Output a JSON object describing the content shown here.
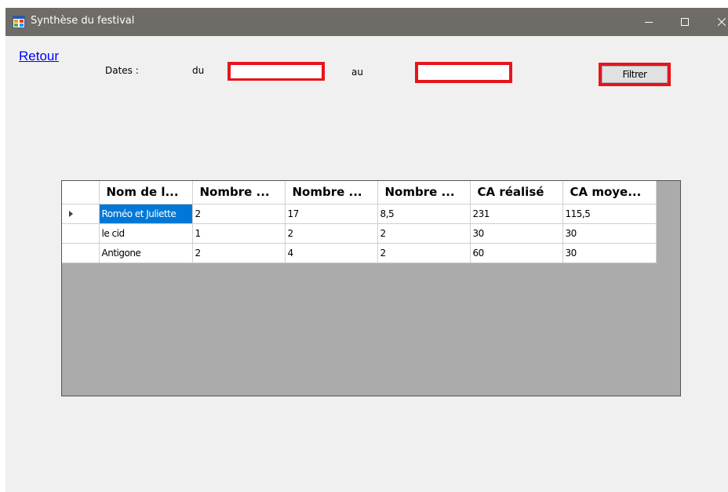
{
  "window": {
    "title": "Synthèse du festival",
    "app_icon": "winforms-app-icon",
    "controls": {
      "minimize": "minimize-icon",
      "maximize": "maximize-icon",
      "close": "close-icon"
    }
  },
  "nav": {
    "back_link": "Retour"
  },
  "filter": {
    "dates_label": "Dates :",
    "from_label": "du",
    "to_label": "au",
    "from_value": "",
    "to_value": "",
    "submit_label": "Filtrer",
    "highlight_color": "#e8141c"
  },
  "table": {
    "columns": [
      "Nom de l...",
      "Nombre ...",
      "Nombre ...",
      "Nombre ...",
      "CA réalisé",
      "CA moye..."
    ],
    "rows": [
      {
        "cells": [
          "Roméo et Juliette",
          "2",
          "17",
          "8,5",
          "231",
          "115,5"
        ],
        "current": true
      },
      {
        "cells": [
          "le cid",
          "1",
          "2",
          "2",
          "30",
          "30"
        ],
        "current": false
      },
      {
        "cells": [
          "Antigone",
          "2",
          "4",
          "2",
          "60",
          "30"
        ],
        "current": false
      }
    ],
    "selection_color": "#0078d7",
    "background_color": "#ababab"
  }
}
